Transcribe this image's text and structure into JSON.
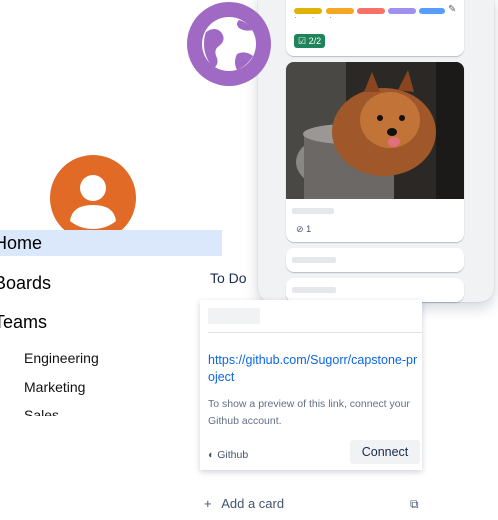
{
  "board": {
    "card_labels": [
      "#e2b203",
      "#f5a623",
      "#f87168",
      "#9f8fef",
      "#579dff"
    ],
    "checklist_badge": "2/2",
    "attachment_count": "1"
  },
  "sidebar": {
    "items": [
      {
        "label": "Home"
      },
      {
        "label": "Boards"
      },
      {
        "label": "Teams"
      }
    ],
    "teams": [
      "Engineering",
      "Marketing",
      "Sales"
    ]
  },
  "list": {
    "title": "To Do",
    "link_url": "https://github.com/Sugorr/capstone-project",
    "preview_info": "To show a preview of this link, connect your Github account.",
    "provider": "Github",
    "connect_label": "Connect",
    "add_card_label": "Add a card"
  },
  "colors": {
    "accent_purple": "#a069c3",
    "avatar_orange": "#e06a26",
    "active_bg": "#dbe8fb"
  }
}
